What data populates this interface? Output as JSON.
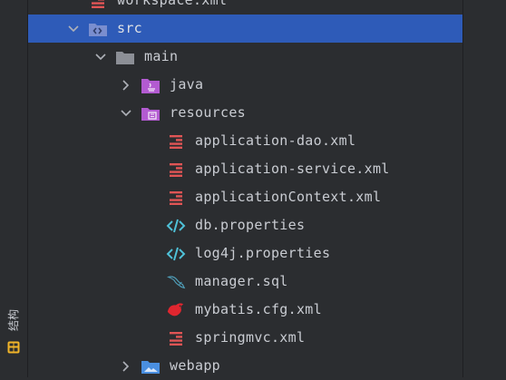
{
  "tree": {
    "rows": [
      {
        "label": "workspace.xml",
        "icon": "xml-file-icon",
        "expanded": null,
        "selected": false
      },
      {
        "label": "src",
        "icon": "source-folder-icon",
        "expanded": true,
        "selected": true
      },
      {
        "label": "main",
        "icon": "folder-icon",
        "expanded": true,
        "selected": false
      },
      {
        "label": "java",
        "icon": "java-source-root-icon",
        "expanded": false,
        "selected": false
      },
      {
        "label": "resources",
        "icon": "resources-root-icon",
        "expanded": true,
        "selected": false
      },
      {
        "label": "application-dao.xml",
        "icon": "xml-file-icon",
        "expanded": null,
        "selected": false
      },
      {
        "label": "application-service.xml",
        "icon": "xml-file-icon",
        "expanded": null,
        "selected": false
      },
      {
        "label": "applicationContext.xml",
        "icon": "xml-file-icon",
        "expanded": null,
        "selected": false
      },
      {
        "label": "db.properties",
        "icon": "properties-file-icon",
        "expanded": null,
        "selected": false
      },
      {
        "label": "log4j.properties",
        "icon": "properties-file-icon",
        "expanded": null,
        "selected": false
      },
      {
        "label": "manager.sql",
        "icon": "mysql-dolphin-icon",
        "expanded": null,
        "selected": false
      },
      {
        "label": "mybatis.cfg.xml",
        "icon": "mybatis-bird-icon",
        "expanded": null,
        "selected": false
      },
      {
        "label": "springmvc.xml",
        "icon": "xml-file-icon",
        "expanded": null,
        "selected": false
      },
      {
        "label": "webapp",
        "icon": "web-folder-icon",
        "expanded": false,
        "selected": false
      }
    ]
  },
  "structure_tab": {
    "label": "结构",
    "icon": "structure-icon"
  },
  "colors": {
    "background": "#2b2d30",
    "selection": "#2e5bb8",
    "text": "#c9ccd2",
    "xml_icon": "#e05555",
    "properties_icon": "#4fc1d8",
    "folder_purple": "#b35bd1",
    "webapp_blue": "#4a8fe0",
    "structure_icon": "#f0b429"
  }
}
